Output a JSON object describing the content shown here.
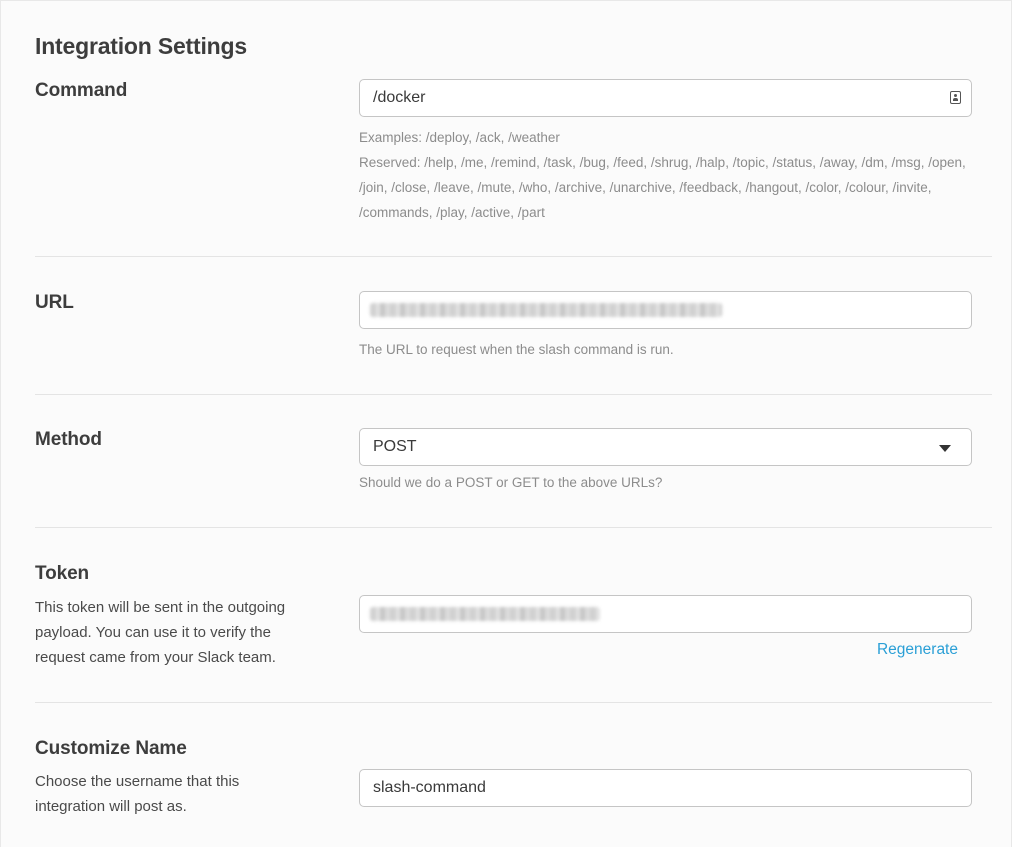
{
  "page_title": "Integration Settings",
  "command": {
    "label": "Command",
    "value": "/docker",
    "icon": "contact-card-icon",
    "examples": "Examples: /deploy, /ack, /weather",
    "reserved": "Reserved: /help, /me, /remind, /task, /bug, /feed, /shrug, /halp, /topic, /status, /away, /dm, /msg, /open, /join, /close, /leave, /mute, /who, /archive, /unarchive, /feedback, /hangout, /color, /colour, /invite, /commands, /play, /active, /part"
  },
  "url": {
    "label": "URL",
    "value": "",
    "value_obscured": true,
    "hint": "The URL to request when the slash command is run."
  },
  "method": {
    "label": "Method",
    "selected": "POST",
    "hint": "Should we do a POST or GET to the above URLs?"
  },
  "token": {
    "label": "Token",
    "description": "This token will be sent in the outgoing payload. You can use it to verify the request came from your Slack team.",
    "value": "",
    "value_obscured": true,
    "regenerate_label": "Regenerate"
  },
  "customize_name": {
    "label": "Customize Name",
    "description": "Choose the username that this integration will post as.",
    "value": "slash-command"
  },
  "colors": {
    "link": "#2a9fd6",
    "text": "#3d3d3d",
    "hint": "#8c8c8c",
    "border": "#c5c5c5"
  }
}
